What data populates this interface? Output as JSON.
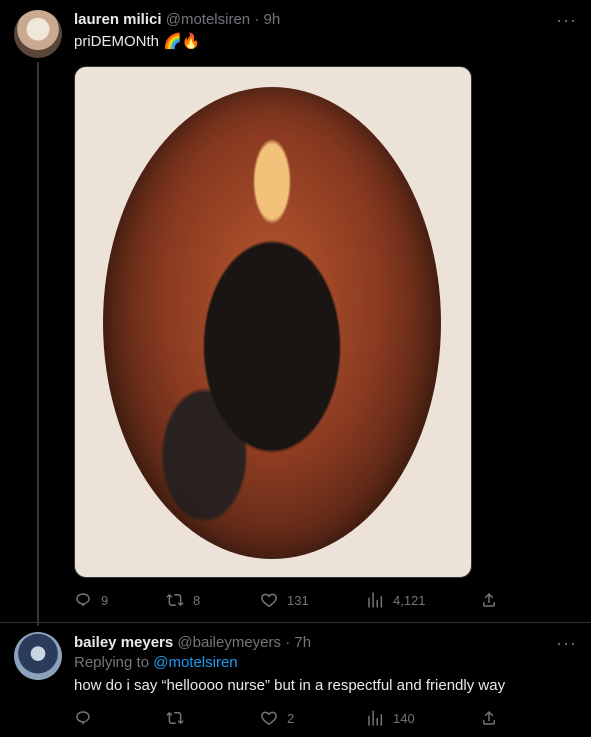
{
  "tweets": [
    {
      "name": "lauren milici",
      "handle": "@motelsiren",
      "time": "· 9h",
      "text": "priDEMONth 🌈🔥",
      "actions": {
        "replies": "9",
        "retweets": "8",
        "likes": "131",
        "views": "4,121"
      }
    },
    {
      "name": "bailey meyers",
      "handle": "@baileymeyers",
      "time": "· 7h",
      "replying_prefix": "Replying to",
      "replying_handle": "@motelsiren",
      "text": "how do i say “helloooo nurse” but in a respectful and friendly way",
      "actions": {
        "replies": "",
        "retweets": "",
        "likes": "2",
        "views": "140"
      }
    }
  ],
  "icons": {
    "reply": "reply-icon",
    "retweet": "retweet-icon",
    "like": "heart-icon",
    "views": "bar-chart-icon",
    "share": "share-icon",
    "more": "more-icon"
  },
  "colors": {
    "background": "#000000",
    "text": "#e7e9ea",
    "muted": "#71767b",
    "accent": "#1d9bf0"
  }
}
